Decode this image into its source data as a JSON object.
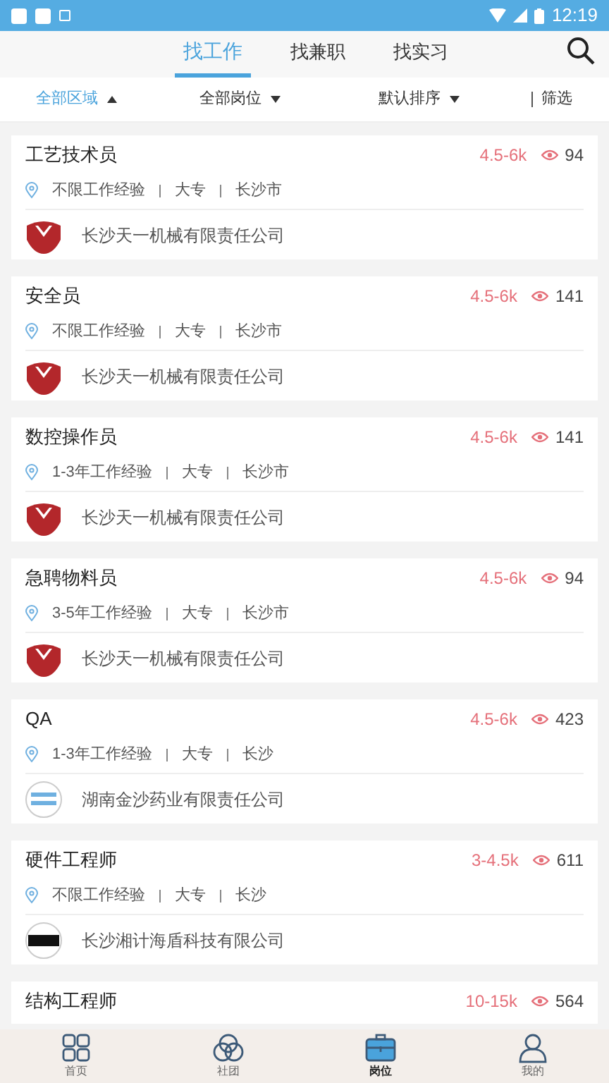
{
  "status_bar": {
    "time": "12:19"
  },
  "tabs": [
    {
      "label": "找工作",
      "selected": true
    },
    {
      "label": "找兼职",
      "selected": false
    },
    {
      "label": "找实习",
      "selected": false
    }
  ],
  "filters": [
    {
      "label": "全部区域",
      "expanded": true
    },
    {
      "label": "全部岗位",
      "expanded": false
    },
    {
      "label": "默认排序",
      "expanded": false
    }
  ],
  "filter_button": {
    "label": "筛选"
  },
  "jobs": [
    {
      "title": "工艺技术员",
      "salary": "4.5-6k",
      "views": "94",
      "experience": "不限工作经验",
      "education": "大专",
      "city": "长沙市",
      "company": "长沙天一机械有限责任公司",
      "logo": {
        "kind": "red"
      }
    },
    {
      "title": "安全员",
      "salary": "4.5-6k",
      "views": "141",
      "experience": "不限工作经验",
      "education": "大专",
      "city": "长沙市",
      "company": "长沙天一机械有限责任公司",
      "logo": {
        "kind": "red"
      }
    },
    {
      "title": "数控操作员",
      "salary": "4.5-6k",
      "views": "141",
      "experience": "1-3年工作经验",
      "education": "大专",
      "city": "长沙市",
      "company": "长沙天一机械有限责任公司",
      "logo": {
        "kind": "red"
      }
    },
    {
      "title": "急聘物料员",
      "salary": "4.5-6k",
      "views": "94",
      "experience": "3-5年工作经验",
      "education": "大专",
      "city": "长沙市",
      "company": "长沙天一机械有限责任公司",
      "logo": {
        "kind": "red"
      }
    },
    {
      "title": "QA",
      "salary": "4.5-6k",
      "views": "423",
      "experience": "1-3年工作经验",
      "education": "大专",
      "city": "长沙",
      "company": "湖南金沙药业有限责任公司",
      "logo": {
        "kind": "blue"
      }
    },
    {
      "title": "硬件工程师",
      "salary": "3-4.5k",
      "views": "611",
      "experience": "不限工作经验",
      "education": "大专",
      "city": "长沙",
      "company": "长沙湘计海盾科技有限公司",
      "logo": {
        "kind": "black"
      }
    },
    {
      "title": "结构工程师",
      "salary": "10-15k",
      "views": "564"
    }
  ],
  "nav": [
    {
      "label": "首页",
      "kind": "grid",
      "selected": false
    },
    {
      "label": "社团",
      "kind": "circles",
      "selected": false
    },
    {
      "label": "岗位",
      "kind": "briefcase",
      "selected": true
    },
    {
      "label": "我的",
      "kind": "person",
      "selected": false
    }
  ]
}
